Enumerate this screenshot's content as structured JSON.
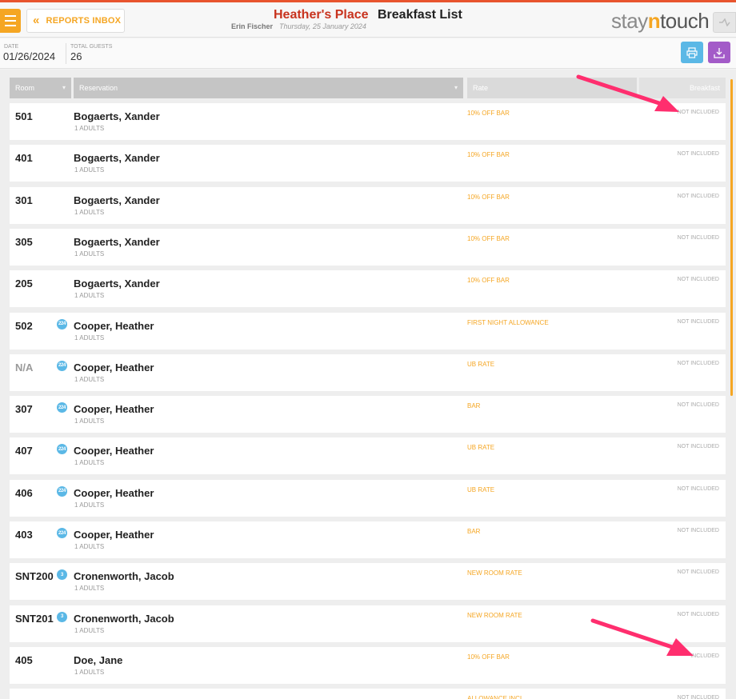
{
  "header": {
    "back_label": "REPORTS INBOX",
    "hotel_name": "Heather's Place",
    "report_title": "Breakfast List",
    "user_name": "Erin Fischer",
    "report_date": "Thursday, 25 January 2024",
    "logo": {
      "part1": "stay",
      "part2": "n",
      "part3": "touch"
    },
    "accent_color": "#f5a623",
    "brand_red": "#c8331e"
  },
  "filters": {
    "date_label": "DATE",
    "date_value": "01/26/2024",
    "guests_label": "TOTAL GUESTS",
    "guests_value": "26"
  },
  "table": {
    "columns": [
      "Room",
      "Reservation",
      "Rate",
      "Breakfast"
    ],
    "rows": [
      {
        "room": "501",
        "badge": "",
        "guest": "Bogaerts, Xander",
        "adults": "1 ADULTS",
        "rate": "10% OFF BAR",
        "breakfast": "NOT INCLUDED"
      },
      {
        "room": "401",
        "badge": "",
        "guest": "Bogaerts, Xander",
        "adults": "1 ADULTS",
        "rate": "10% OFF BAR",
        "breakfast": "NOT INCLUDED"
      },
      {
        "room": "301",
        "badge": "",
        "guest": "Bogaerts, Xander",
        "adults": "1 ADULTS",
        "rate": "10% OFF BAR",
        "breakfast": "NOT INCLUDED"
      },
      {
        "room": "305",
        "badge": "",
        "guest": "Bogaerts, Xander",
        "adults": "1 ADULTS",
        "rate": "10% OFF BAR",
        "breakfast": "NOT INCLUDED"
      },
      {
        "room": "205",
        "badge": "",
        "guest": "Bogaerts, Xander",
        "adults": "1 ADULTS",
        "rate": "10% OFF BAR",
        "breakfast": "NOT INCLUDED"
      },
      {
        "room": "502",
        "badge": "224",
        "guest": "Cooper, Heather",
        "adults": "1 ADULTS",
        "rate": "FIRST NIGHT ALLOWANCE",
        "breakfast": "NOT INCLUDED"
      },
      {
        "room": "N/A",
        "badge": "224",
        "guest": "Cooper, Heather",
        "adults": "1 ADULTS",
        "rate": "UB RATE",
        "breakfast": "NOT INCLUDED"
      },
      {
        "room": "307",
        "badge": "224",
        "guest": "Cooper, Heather",
        "adults": "1 ADULTS",
        "rate": "BAR",
        "breakfast": "NOT INCLUDED"
      },
      {
        "room": "407",
        "badge": "224",
        "guest": "Cooper, Heather",
        "adults": "1 ADULTS",
        "rate": "UB RATE",
        "breakfast": "NOT INCLUDED"
      },
      {
        "room": "406",
        "badge": "224",
        "guest": "Cooper, Heather",
        "adults": "1 ADULTS",
        "rate": "UB RATE",
        "breakfast": "NOT INCLUDED"
      },
      {
        "room": "403",
        "badge": "224",
        "guest": "Cooper, Heather",
        "adults": "1 ADULTS",
        "rate": "BAR",
        "breakfast": "NOT INCLUDED"
      },
      {
        "room": "SNT200",
        "badge": "3",
        "guest": "Cronenworth, Jacob",
        "adults": "1 ADULTS",
        "rate": "NEW ROOM RATE",
        "breakfast": "NOT INCLUDED"
      },
      {
        "room": "SNT201",
        "badge": "3",
        "guest": "Cronenworth, Jacob",
        "adults": "1 ADULTS",
        "rate": "NEW ROOM RATE",
        "breakfast": "NOT INCLUDED"
      },
      {
        "room": "405",
        "badge": "",
        "guest": "Doe, Jane",
        "adults": "1 ADULTS",
        "rate": "10% OFF BAR",
        "breakfast": "INCLUDED"
      },
      {
        "room": "",
        "badge": "",
        "guest": "",
        "adults": "",
        "rate": "ALLOWANCE INCL",
        "breakfast": "NOT INCLUDED"
      }
    ]
  },
  "annotations": {
    "arrow_color": "#ff2e6e"
  },
  "icons": {
    "menu": "hamburger-icon",
    "back": "double-chevron-left-icon",
    "print": "printer-icon",
    "download": "download-icon",
    "collapse": "chevron-wave-icon"
  }
}
